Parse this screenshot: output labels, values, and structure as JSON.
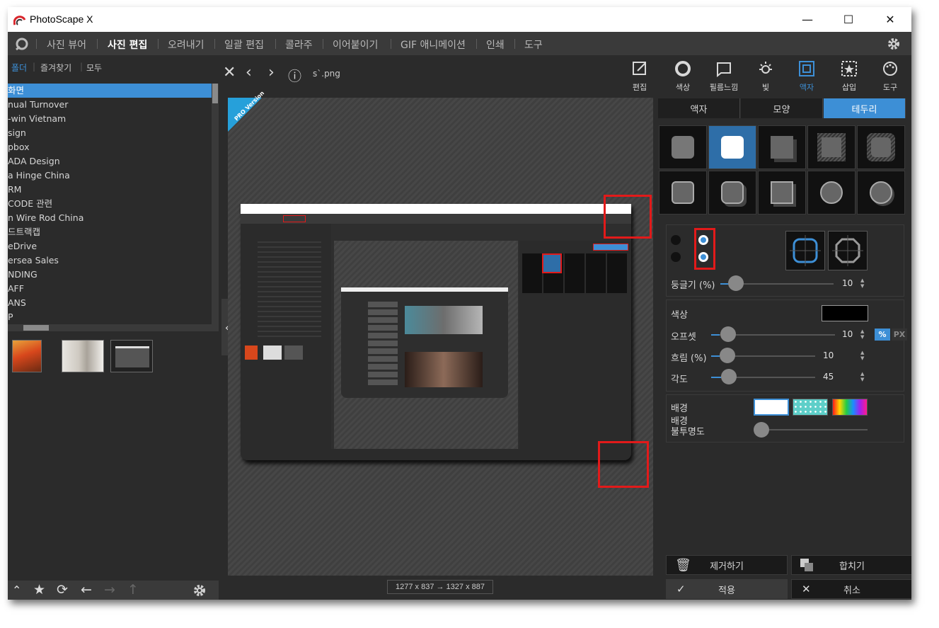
{
  "window": {
    "title": "PhotoScape X",
    "minimize": "—",
    "maximize": "☐",
    "close": "✕"
  },
  "menu": {
    "items": [
      "사진 뷰어",
      "사진 편집",
      "오려내기",
      "일괄 편집",
      "콜라주",
      "이어붙이기",
      "GIF 애니메이션",
      "인쇄",
      "도구"
    ],
    "active": "사진 편집"
  },
  "left_panel": {
    "tabs": [
      "폴더",
      "즐겨찾기",
      "모두"
    ],
    "tree": [
      "화면",
      "nual Turnover",
      "-win Vietnam",
      "sign",
      "pbox",
      "ADA Design",
      "a Hinge China",
      "RM",
      "CODE 관련",
      "n Wire Rod China",
      "드트랙캡",
      "eDrive",
      "ersea Sales",
      "NDING",
      "AFF",
      "ANS",
      "P"
    ],
    "selected": "화면",
    "thumbnails": [
      "orange-flower",
      "room-photo",
      "app-screenshot"
    ]
  },
  "toolbar": {
    "filename": "s`.png",
    "tools": [
      "편집",
      "색상",
      "필름느낌",
      "빛",
      "액자",
      "삽입",
      "도구"
    ],
    "active_tool": "액자"
  },
  "canvas": {
    "badge": "PRO Version",
    "dimensions": "1277 x 837 → 1327 x 887"
  },
  "frame_panel": {
    "tabs": [
      "액자",
      "모양",
      "테두리"
    ],
    "active_tab": "테두리",
    "roundness_label": "둥글기 (%)",
    "roundness_value": "10",
    "color_label": "색상",
    "color_value": "#000000",
    "offset_label": "오프셋",
    "offset_value": "10",
    "unit_percent": "%",
    "unit_px": "PX",
    "blur_label": "흐림 (%)",
    "blur_value": "10",
    "angle_label": "각도",
    "angle_value": "45",
    "background_label": "배경",
    "bg_opacity_label": "배경\n불투명도",
    "remove_label": "제거하기",
    "merge_label": "합치기",
    "apply_label": "적용",
    "cancel_label": "취소"
  }
}
